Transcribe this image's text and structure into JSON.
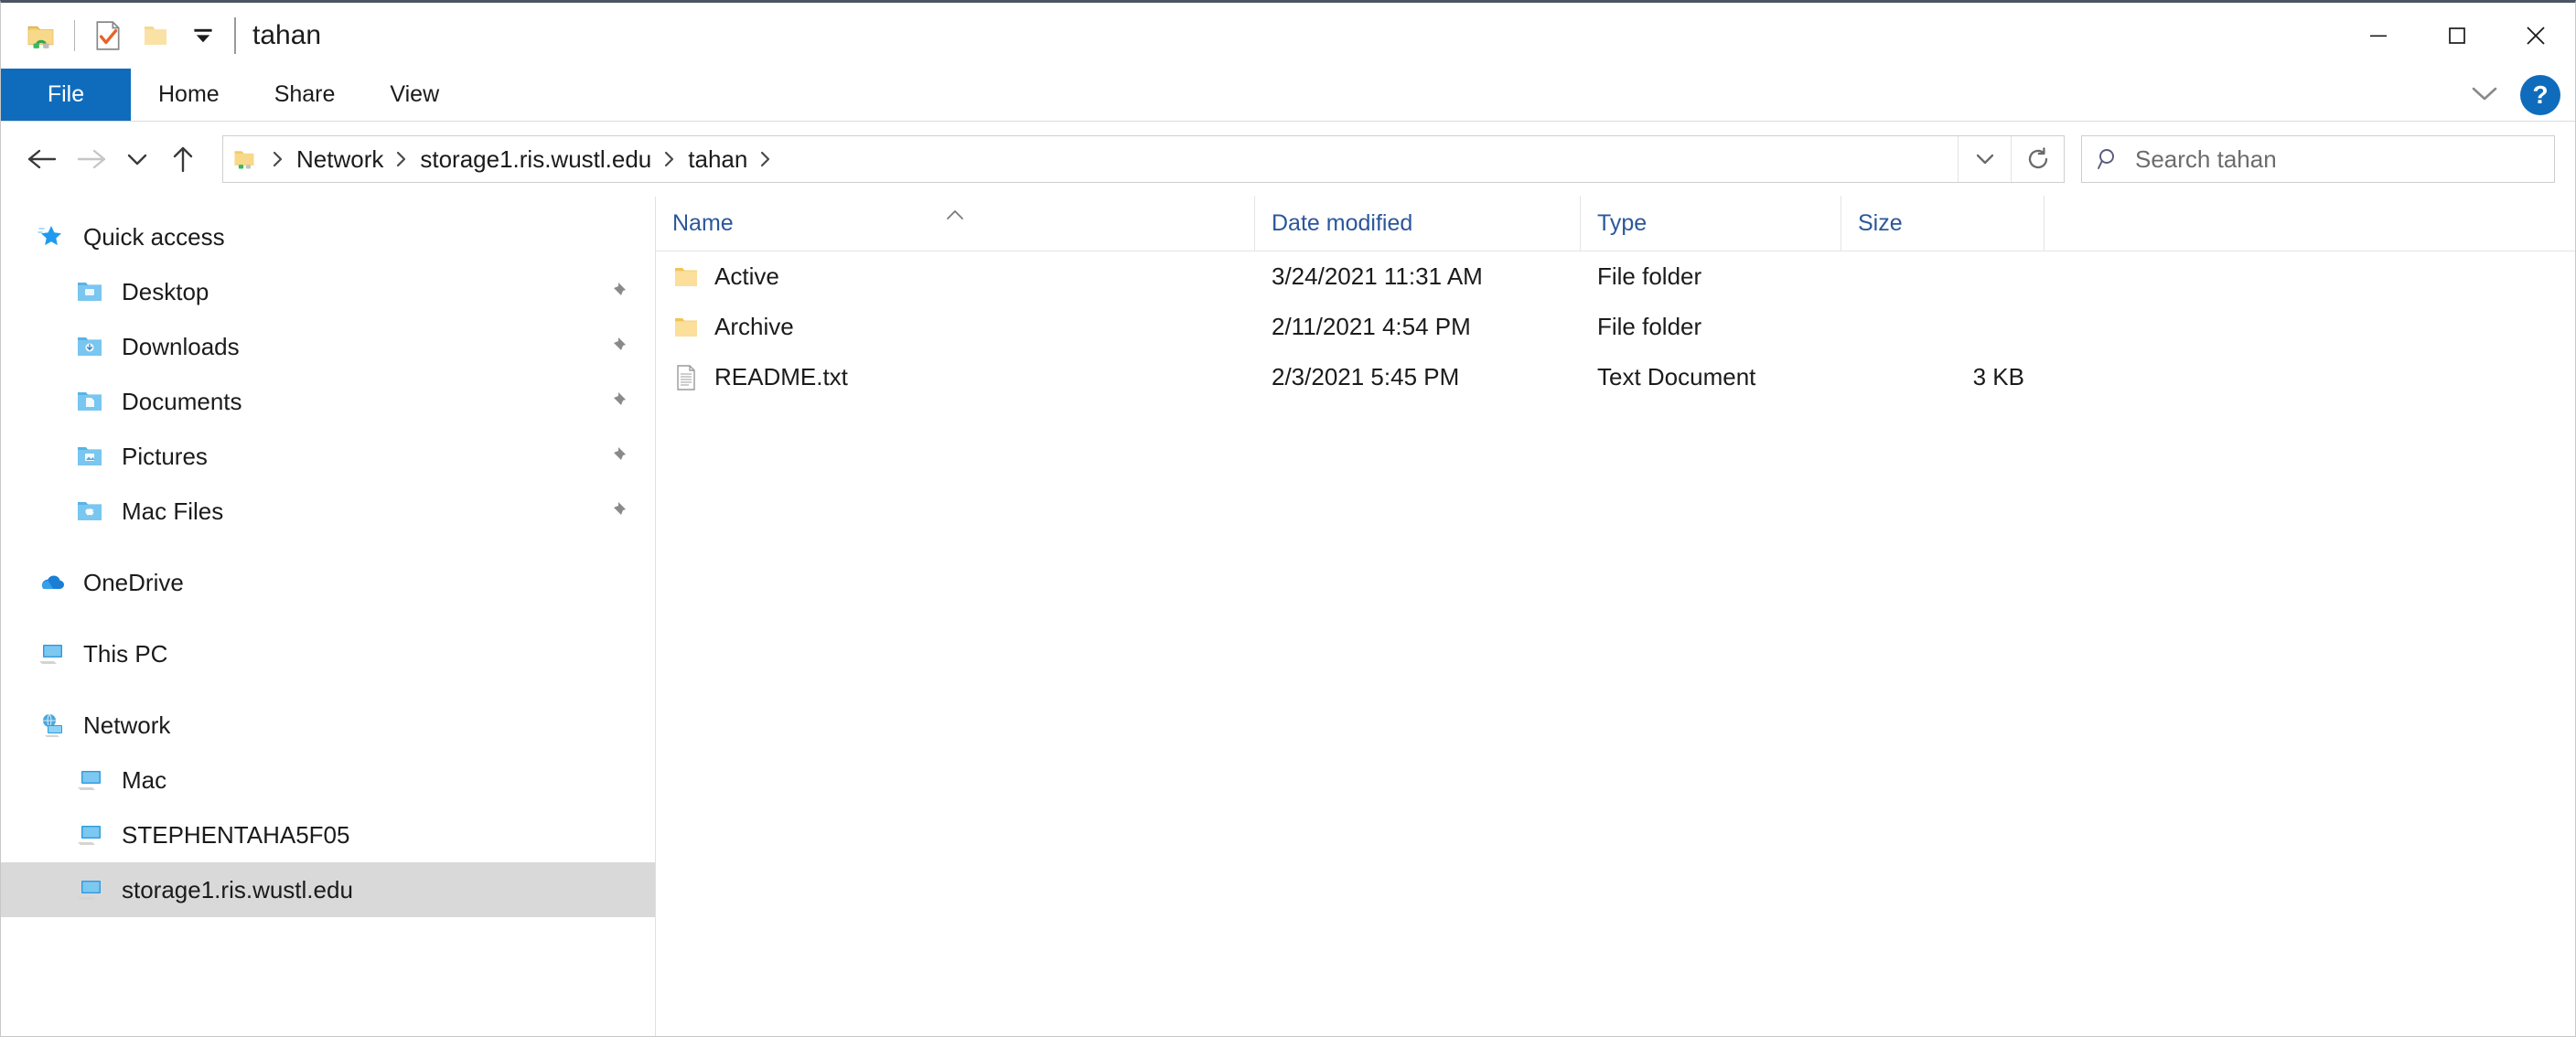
{
  "window": {
    "title": "tahan",
    "controls": {
      "minimize": "Minimize",
      "maximize": "Maximize",
      "close": "Close"
    }
  },
  "quick_access_toolbar": {
    "items": [
      {
        "name": "network-folder-icon",
        "label": "tahan"
      },
      {
        "name": "properties-icon",
        "label": "Properties"
      },
      {
        "name": "new-folder-icon",
        "label": "New folder"
      },
      {
        "name": "customize-dropdown-icon",
        "label": "Customize Quick Access Toolbar"
      }
    ]
  },
  "ribbon": {
    "tabs": [
      {
        "label": "File",
        "selected": true
      },
      {
        "label": "Home",
        "selected": false
      },
      {
        "label": "Share",
        "selected": false
      },
      {
        "label": "View",
        "selected": false
      }
    ],
    "expand_label": "Expand the Ribbon",
    "help_label": "?"
  },
  "navigation": {
    "back_label": "Back",
    "forward_label": "Forward",
    "recent_label": "Recent locations",
    "up_label": "Up"
  },
  "address": {
    "crumbs": [
      "Network",
      "storage1.ris.wustl.edu",
      "tahan"
    ],
    "separator": "›",
    "dropdown_label": "Previous Locations",
    "refresh_label": "Refresh"
  },
  "search": {
    "placeholder": "Search tahan",
    "value": "",
    "icon": "search-icon"
  },
  "sidebar": {
    "groups": [
      {
        "header": {
          "label": "Quick access",
          "icon": "star-icon"
        },
        "items": [
          {
            "label": "Desktop",
            "icon": "folder-desktop-icon",
            "pinned": true
          },
          {
            "label": "Downloads",
            "icon": "folder-downloads-icon",
            "pinned": true
          },
          {
            "label": "Documents",
            "icon": "folder-documents-icon",
            "pinned": true
          },
          {
            "label": "Pictures",
            "icon": "folder-pictures-icon",
            "pinned": true
          },
          {
            "label": "Mac Files",
            "icon": "folder-mac-icon",
            "pinned": true
          }
        ]
      },
      {
        "header": {
          "label": "OneDrive",
          "icon": "cloud-icon"
        },
        "items": []
      },
      {
        "header": {
          "label": "This PC",
          "icon": "pc-icon"
        },
        "items": []
      },
      {
        "header": {
          "label": "Network",
          "icon": "network-globe-icon"
        },
        "items": [
          {
            "label": "Mac",
            "icon": "pc-icon",
            "pinned": false,
            "selected": false
          },
          {
            "label": "STEPHENTAHA5F05",
            "icon": "pc-icon",
            "pinned": false,
            "selected": false
          },
          {
            "label": "storage1.ris.wustl.edu",
            "icon": "pc-icon",
            "pinned": false,
            "selected": true
          }
        ]
      }
    ]
  },
  "file_list": {
    "columns": [
      {
        "key": "name",
        "label": "Name",
        "sorted": "asc"
      },
      {
        "key": "date",
        "label": "Date modified",
        "sorted": ""
      },
      {
        "key": "type",
        "label": "Type",
        "sorted": ""
      },
      {
        "key": "size",
        "label": "Size",
        "sorted": ""
      }
    ],
    "rows": [
      {
        "name": "Active",
        "date": "3/24/2021 11:31 AM",
        "type": "File folder",
        "size": "",
        "icon": "folder-icon"
      },
      {
        "name": "Archive",
        "date": "2/11/2021 4:54 PM",
        "type": "File folder",
        "size": "",
        "icon": "folder-icon"
      },
      {
        "name": "README.txt",
        "date": "2/3/2021 5:45 PM",
        "type": "Text Document",
        "size": "3 KB",
        "icon": "text-file-icon"
      }
    ]
  },
  "colors": {
    "accent": "#0f6cbd",
    "header_text": "#2b579a",
    "selection": "#d9d9d9",
    "folder_yellow": "#f7d070",
    "titlebar_border": "#4a5562"
  }
}
